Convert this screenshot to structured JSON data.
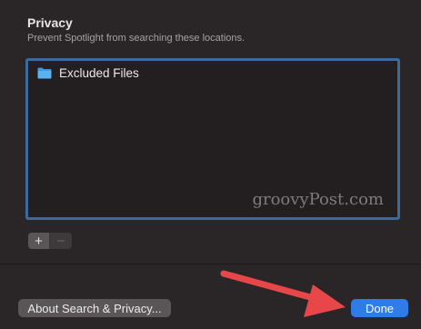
{
  "privacy": {
    "title": "Privacy",
    "subtitle": "Prevent Spotlight from searching these locations."
  },
  "excluded_list": {
    "items": [
      {
        "label": "Excluded Files",
        "icon": "folder-icon"
      }
    ]
  },
  "watermark": "groovyPost.com",
  "list_controls": {
    "add_label": "+",
    "remove_label": "−"
  },
  "footer": {
    "about_label": "About Search & Privacy...",
    "done_label": "Done"
  },
  "colors": {
    "accent": "#2f7ce6",
    "list_border": "#3a6b9c",
    "annotation_arrow": "#e8474a"
  }
}
